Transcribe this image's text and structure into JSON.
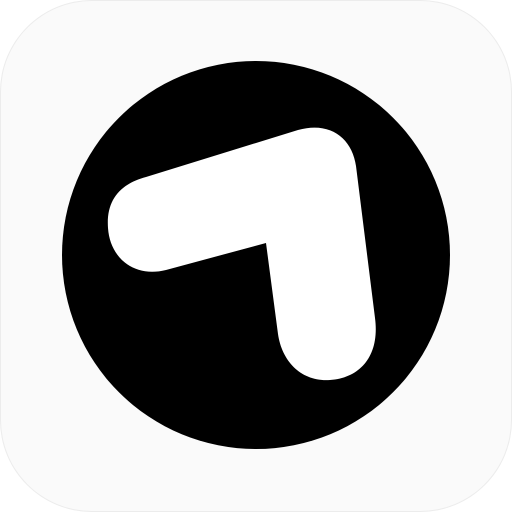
{
  "app_icon": {
    "icon_name": "arrow-up-left-circle-icon",
    "colors": {
      "tile_background": "#fafafa",
      "circle": "#000000",
      "arrow": "#ffffff"
    }
  }
}
